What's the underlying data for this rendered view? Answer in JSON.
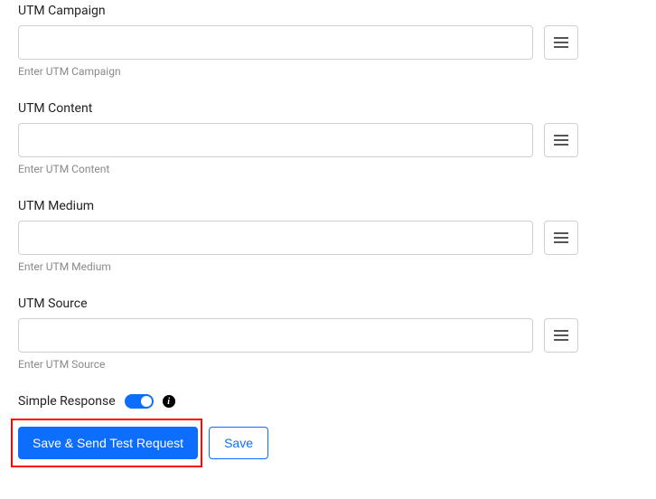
{
  "fields": [
    {
      "label": "UTM Campaign",
      "value": "",
      "helper": "Enter UTM Campaign",
      "name": "utm-campaign"
    },
    {
      "label": "UTM Content",
      "value": "",
      "helper": "Enter UTM Content",
      "name": "utm-content"
    },
    {
      "label": "UTM Medium",
      "value": "",
      "helper": "Enter UTM Medium",
      "name": "utm-medium"
    },
    {
      "label": "UTM Source",
      "value": "",
      "helper": "Enter UTM Source",
      "name": "utm-source"
    }
  ],
  "simpleResponse": {
    "label": "Simple Response",
    "enabled": true
  },
  "buttons": {
    "primary": "Save & Send Test Request",
    "secondary": "Save"
  }
}
